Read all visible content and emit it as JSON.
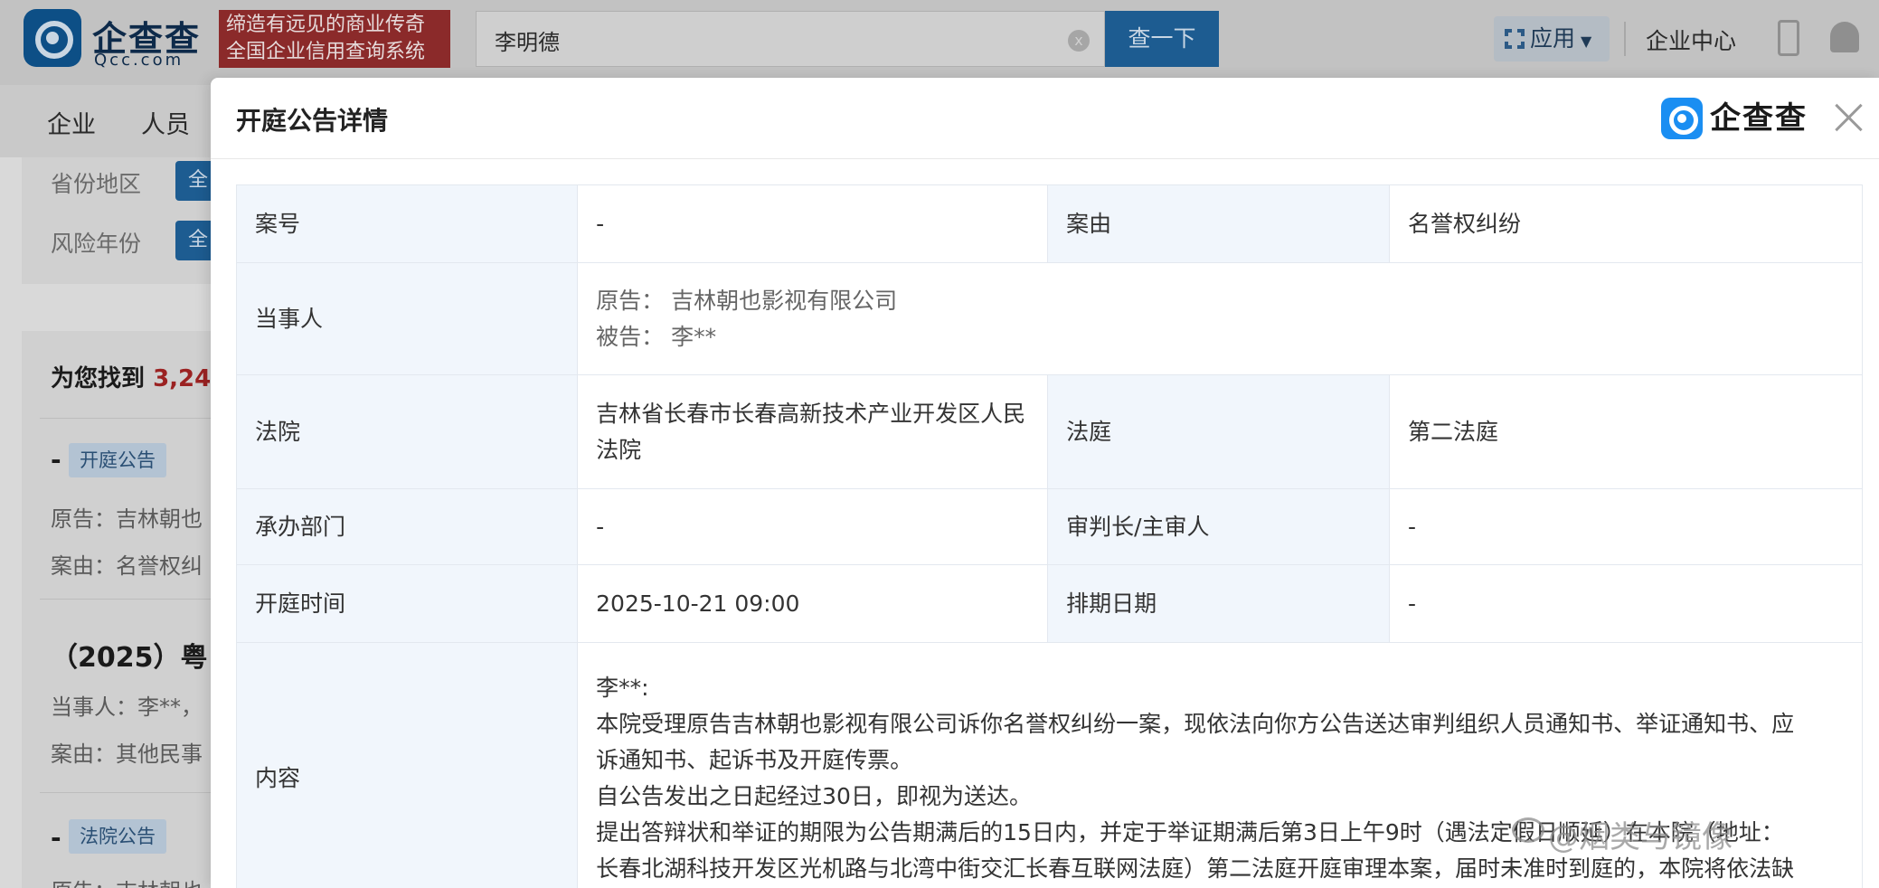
{
  "header": {
    "logo_text": "企查查",
    "logo_sub": "Qcc.com",
    "slogan_line1": "缔造有远见的商业传奇",
    "slogan_line2": "全国企业信用查询系统",
    "search_value": "李明德",
    "clear_symbol": "x",
    "search_button": "查一下",
    "app_button": "应用",
    "enterprise_center": "企业中心"
  },
  "nav": {
    "items": [
      "企业",
      "人员"
    ]
  },
  "filters": {
    "province_label": "省份地区",
    "year_label": "风险年份",
    "chip": "全"
  },
  "results": {
    "found_prefix": "为您找到",
    "found_count": "3,24",
    "item1": {
      "dash": "-",
      "tag": "开庭公告",
      "plaintiff": "原告：吉林朝也",
      "cause": "案由：名誉权纠"
    },
    "item2": {
      "title": "（2025）粤",
      "party": "当事人：李**，",
      "cause": "案由：其他民事"
    },
    "item3": {
      "dash": "-",
      "tag": "法院公告",
      "plaintiff": "原告：吉林朝也"
    }
  },
  "modal": {
    "title": "开庭公告详情",
    "logo_text": "企查查",
    "fields": {
      "case_no_label": "案号",
      "case_no_value": "-",
      "cause_label": "案由",
      "cause_value": "名誉权纠纷",
      "parties_label": "当事人",
      "plaintiff": "原告：  吉林朝也影视有限公司",
      "defendant": "被告：  李**",
      "court_label": "法院",
      "court_value": "吉林省长春市长春高新技术产业开发区人民法院",
      "courtroom_label": "法庭",
      "courtroom_value": "第二法庭",
      "department_label": "承办部门",
      "department_value": "-",
      "judge_label": "审判长/主审人",
      "judge_value": "-",
      "hearing_time_label": "开庭时间",
      "hearing_time_value": "2025-10-21 09:00",
      "schedule_date_label": "排期日期",
      "schedule_date_value": "-",
      "content_label": "内容",
      "content_lines": [
        "李**:",
        "本院受理原告吉林朝也影视有限公司诉你名誉权纠纷一案，现依法向你方公告送达审判组织人员通知书、举证通知书、应",
        "诉通知书、起诉书及开庭传票。",
        "自公告发出之日起经过30日，即视为送达。",
        "提出答辩状和举证的期限为公告期满后的15日内，并定于举证期满后第3日上午9时（遇法定假日顺延）在本院（地址：",
        "长春北湖科技开发区光机路与北湾中街交汇长春互联网法庭）第二法庭开庭审理本案，届时未准时到庭的，本院将依法缺"
      ]
    }
  },
  "watermark": "@烟类与镜像"
}
